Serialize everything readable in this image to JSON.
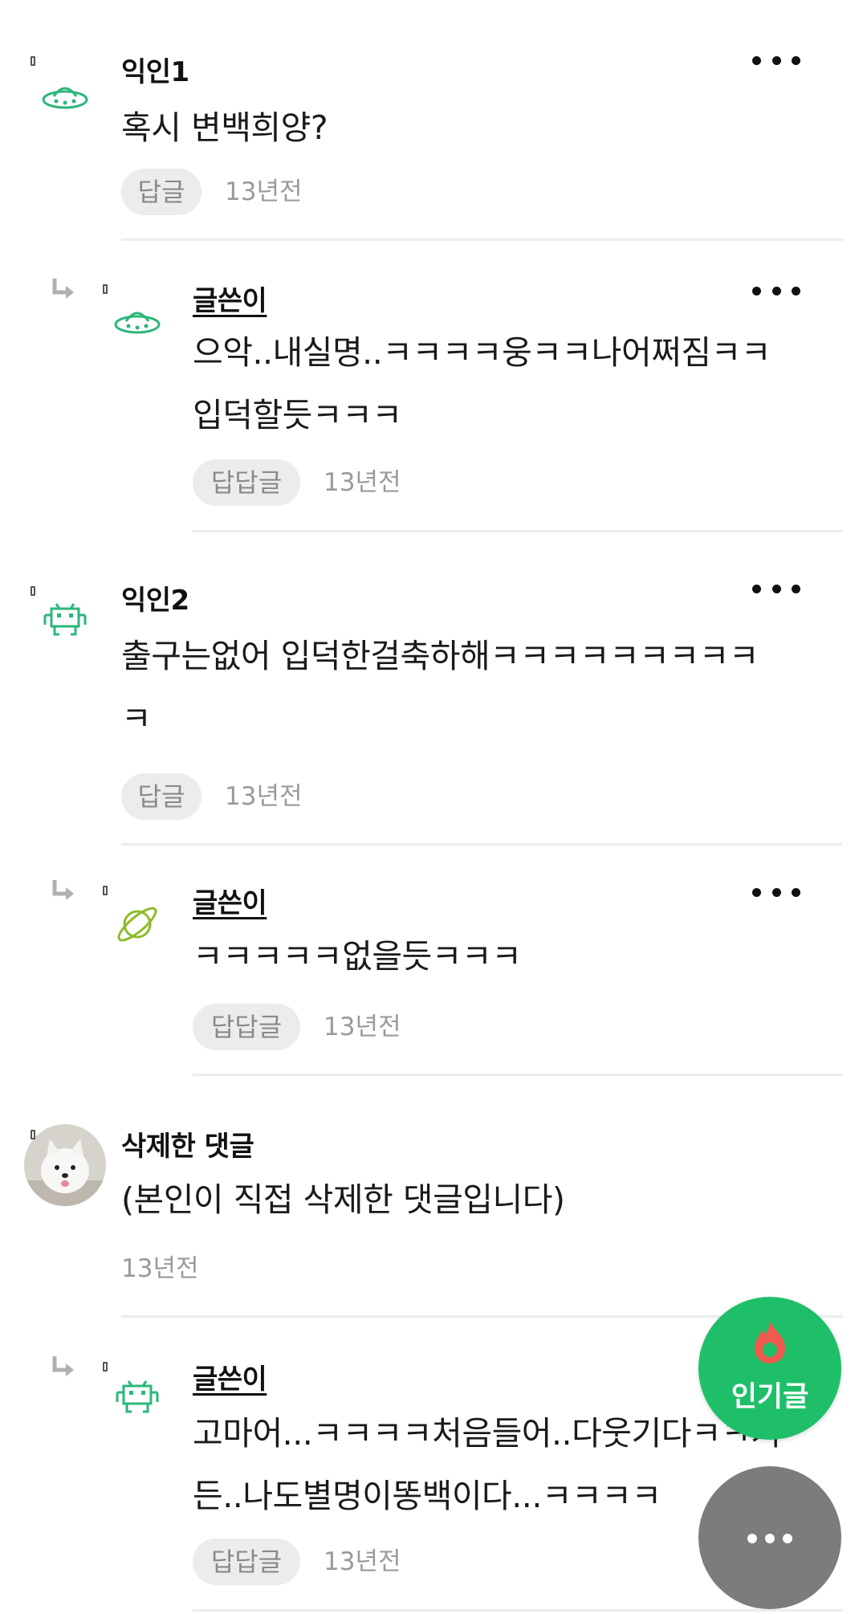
{
  "comments": [
    {
      "author": "익인1",
      "lines": [
        "혹시 변백희양?"
      ],
      "action_label": "답글",
      "time": "13년전",
      "avatar_icon": "ufo-icon",
      "replies": [
        {
          "author": "글쓴이",
          "lines": [
            "으악..내실명..ㅋㅋㅋㅋ웅ㅋㅋ나어쩌짐ㅋㅋ",
            "입덕할듯ㅋㅋㅋ"
          ],
          "action_label": "답답글",
          "time": "13년전",
          "avatar_icon": "ufo-icon"
        }
      ]
    },
    {
      "author": "익인2",
      "lines": [
        "출구는없어 입덕한걸축하해ㅋㅋㅋㅋㅋㅋㅋㅋㅋ",
        "ㅋ"
      ],
      "action_label": "답글",
      "time": "13년전",
      "avatar_icon": "space-invader-icon",
      "replies": [
        {
          "author": "글쓴이",
          "lines": [
            "ㅋㅋㅋㅋㅋ없을듯ㅋㅋㅋ"
          ],
          "action_label": "답답글",
          "time": "13년전",
          "avatar_icon": "planet-icon"
        }
      ]
    },
    {
      "author": "삭제한 댓글",
      "lines": [
        "(본인이 직접 삭제한 댓글입니다)"
      ],
      "time": "13년전",
      "avatar_icon": "dog-photo-avatar",
      "replies": [
        {
          "author": "글쓴이",
          "lines": [
            "고마어...ㅋㅋㅋㅋ처음들어..다웃기다ㅋㅋ거",
            "든..나도별명이똥백이다...ㅋㅋㅋㅋ"
          ],
          "action_label": "답답글",
          "time": "13년전",
          "avatar_icon": "space-invader-icon"
        }
      ]
    }
  ],
  "fab": {
    "popular_label": "인기글",
    "popular_icon": "flame-icon",
    "more_icon": "more-dots-icon"
  },
  "colors": {
    "accent_green": "#1fbf6a",
    "fab_gray": "#7c7c7c",
    "flame": "#f05a4f"
  }
}
